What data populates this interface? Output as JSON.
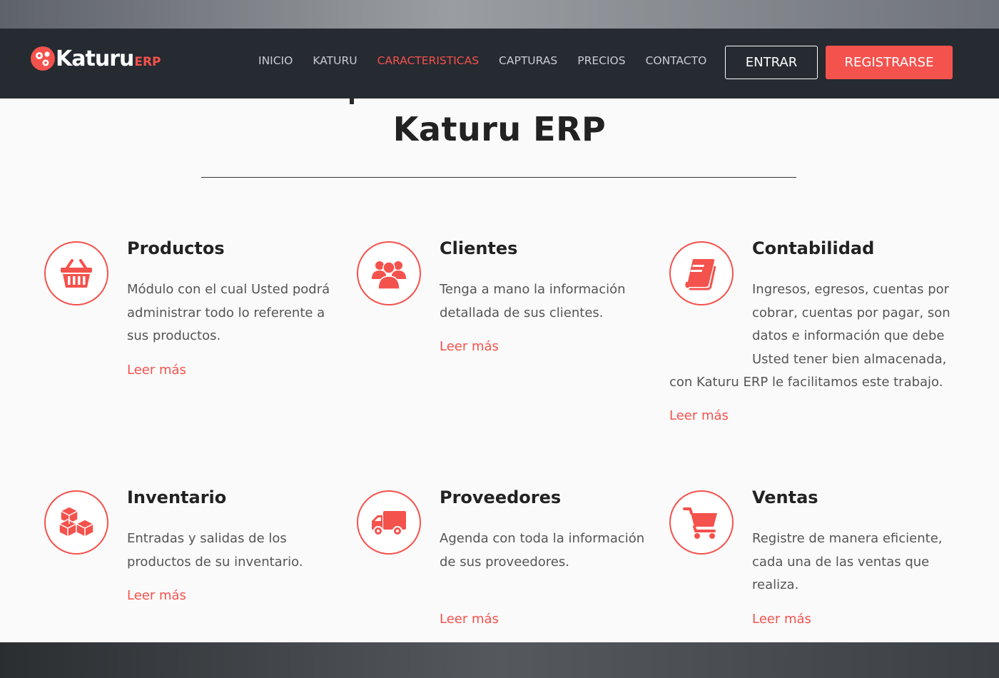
{
  "brand": {
    "name": "Katuru",
    "suffix": "ERP"
  },
  "nav": {
    "links": [
      "INICIO",
      "KATURU",
      "CARACTERISTICAS",
      "CAPTURAS",
      "PRECIOS",
      "CONTACTO"
    ],
    "active": "CARACTERISTICAS",
    "login_label": "ENTRAR",
    "register_label": "REGISTRARSE"
  },
  "page": {
    "title": "Katuru ERP"
  },
  "features": [
    {
      "title": "Productos",
      "description": "Módulo con el cual Usted podrá administrar todo lo referente a sus productos.",
      "link": "Leer más",
      "icon": "basket-icon"
    },
    {
      "title": "Clientes",
      "description": "Tenga a mano la información detallada de sus clientes.",
      "link": "Leer más",
      "icon": "users-icon"
    },
    {
      "title": "Contabilidad",
      "description": "Ingresos, egresos, cuentas por cobrar, cuentas por pagar, son datos e información que debe Usted tener bien almacenada, con Katuru ERP le facilitamos este trabajo.",
      "link": "Leer más",
      "icon": "book-icon"
    },
    {
      "title": "Inventario",
      "description": "Entradas y salidas de los productos de su inventario.",
      "link": "Leer más",
      "icon": "boxes-icon"
    },
    {
      "title": "Proveedores",
      "description": "Agenda con toda la información de sus proveedores.",
      "link": "Leer más",
      "icon": "truck-icon"
    },
    {
      "title": "Ventas",
      "description": "Registre de manera eficiente, cada una de las ventas que realiza.",
      "link": "Leer más",
      "icon": "cart-icon"
    }
  ],
  "colors": {
    "accent": "#f4524d",
    "navbar": "#262a31",
    "background": "#fafafa"
  }
}
